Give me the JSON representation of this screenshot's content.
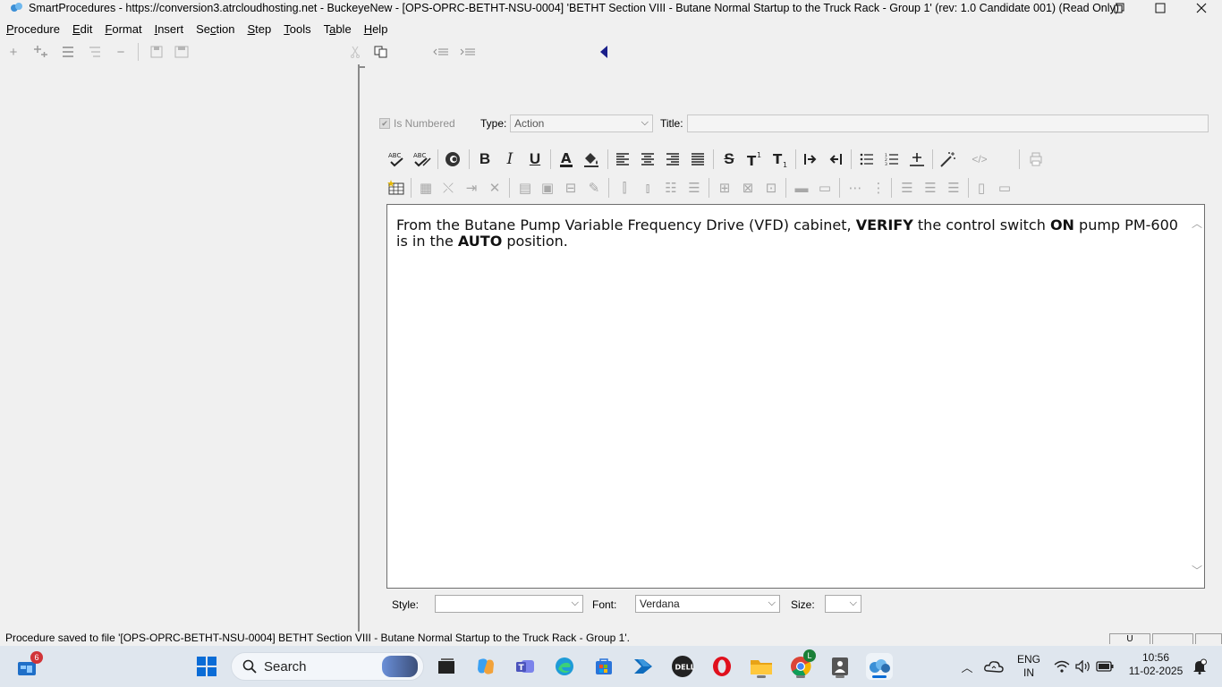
{
  "window": {
    "title": "SmartProcedures - https://conversion3.atrcloudhosting.net - BuckeyeNew - [OPS-OPRC-BETHT-NSU-0004] 'BETHT Section VIII - Butane Normal Startup to the Truck Rack - Group 1' (rev: 1.0 Candidate 001) (Read Only)",
    "restore_icon": "restore-icon",
    "maximize_icon": "maximize-icon",
    "close_icon": "close-icon"
  },
  "menu": {
    "items": [
      {
        "pre": "",
        "key": "P",
        "post": "rocedure"
      },
      {
        "pre": "",
        "key": "E",
        "post": "dit"
      },
      {
        "pre": "",
        "key": "F",
        "post": "ormat"
      },
      {
        "pre": "",
        "key": "I",
        "post": "nsert"
      },
      {
        "pre": "Se",
        "key": "c",
        "post": "tion"
      },
      {
        "pre": "",
        "key": "S",
        "post": "tep"
      },
      {
        "pre": "",
        "key": "T",
        "post": "ools"
      },
      {
        "pre": "T",
        "key": "a",
        "post": "ble"
      },
      {
        "pre": "",
        "key": "H",
        "post": "elp"
      }
    ]
  },
  "step_fields": {
    "is_numbered_label": "Is Numbered",
    "is_numbered_checked": true,
    "type_label": "Type:",
    "type_value": "Action",
    "title_label": "Title:",
    "title_value": ""
  },
  "editor": {
    "seg1": "From the Butane Pump Variable Frequency Drive (VFD) cabinet, ",
    "seg2": "VERIFY",
    "seg3": " the control switch ",
    "seg4": "ON",
    "seg5": " pump PM-600 is in the ",
    "seg6": "AUTO",
    "seg7": " position."
  },
  "format_bar": {
    "style_label": "Style:",
    "style_value": "",
    "font_label": "Font:",
    "font_value": "Verdana",
    "size_label": "Size:",
    "size_value": ""
  },
  "status": {
    "message": "Procedure saved to file '[OPS-OPRC-BETHT-NSU-0004] BETHT Section VIII - Butane Normal Startup to the Truck Rack - Group 1'.",
    "box1": "U"
  },
  "taskbar": {
    "widgets_badge": "6",
    "search_placeholder": "Search",
    "chrome_badge": "L",
    "lang_line1": "ENG",
    "lang_line2": "IN",
    "time": "10:56",
    "date": "11-02-2025"
  }
}
